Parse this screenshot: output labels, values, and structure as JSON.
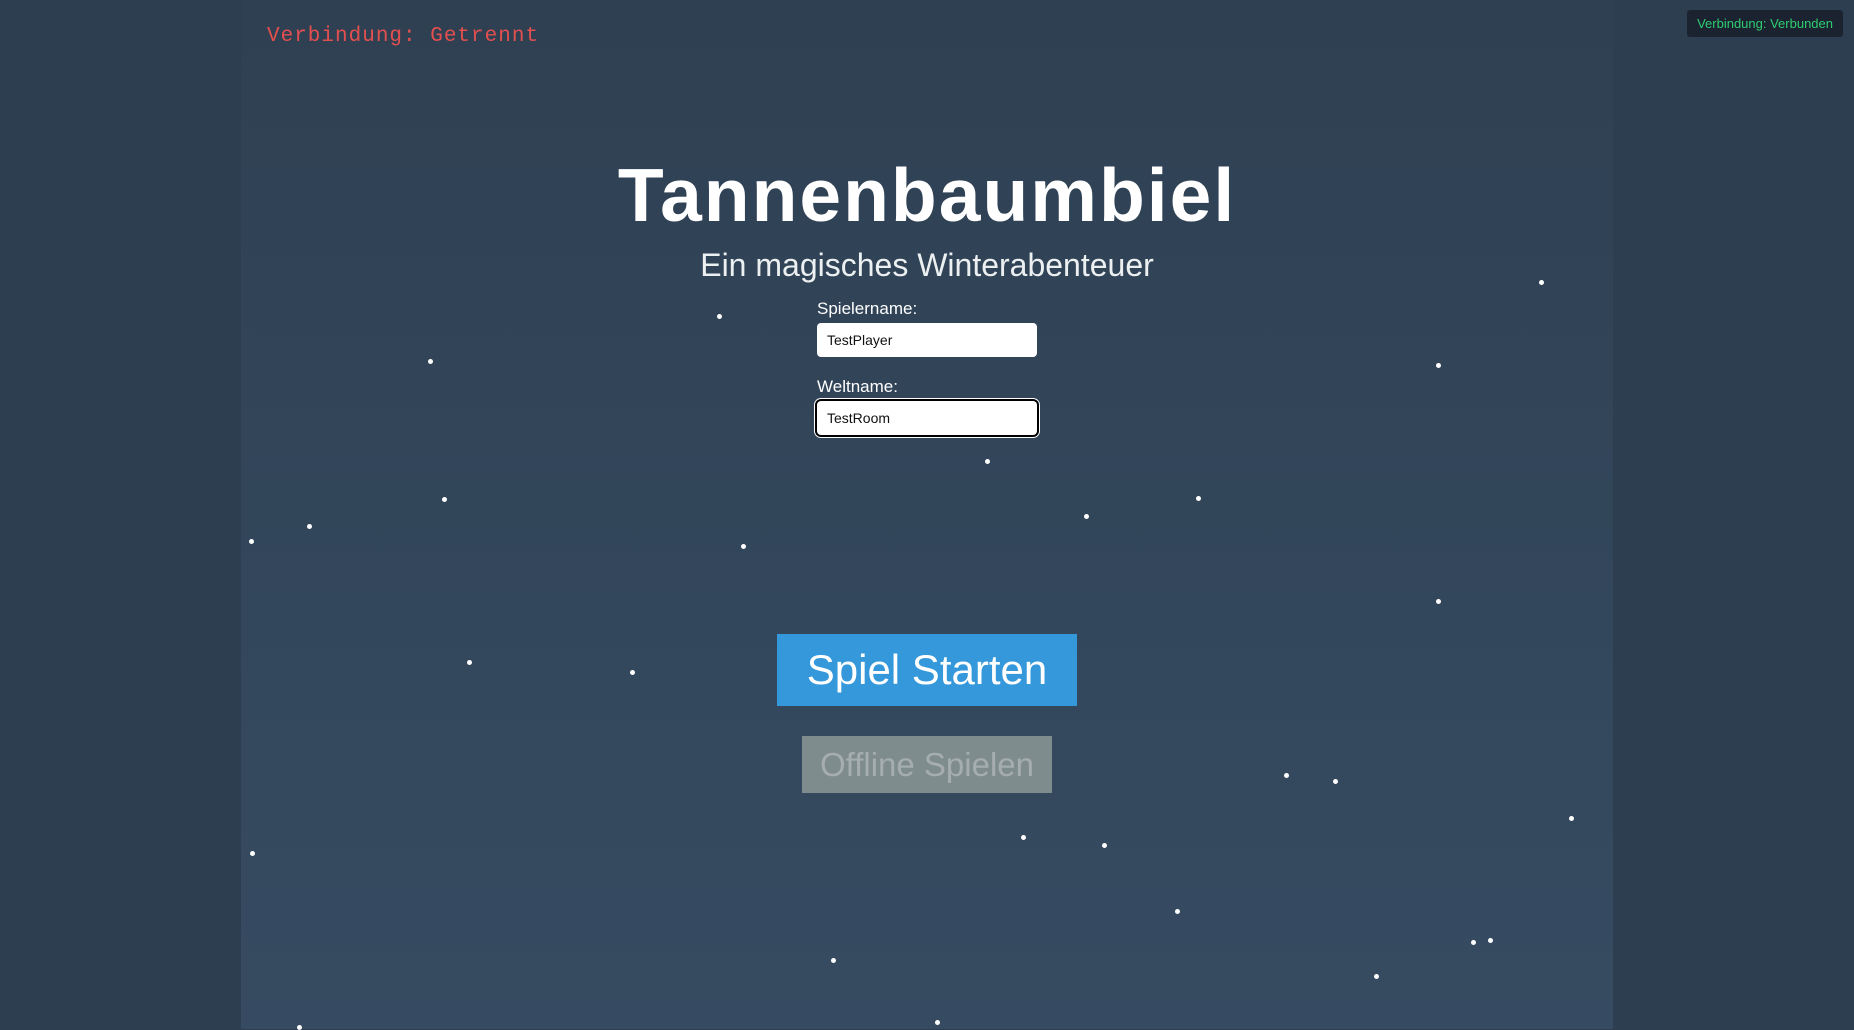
{
  "status": {
    "left": "Verbindung: Getrennt",
    "right": "Verbindung: Verbunden"
  },
  "menu": {
    "title": "Tannenbaumbiel",
    "subtitle": "Ein magisches Winterabenteuer",
    "player_label": "Spielername:",
    "player_value": "TestPlayer",
    "world_label": "Weltname:",
    "world_value": "TestRoom",
    "start_label": "Spiel Starten",
    "offline_label": "Offline Spielen"
  },
  "colors": {
    "background": "#2c3e50",
    "start_button": "#3498db",
    "offline_button": "#7f8c8d",
    "status_disconnected": "#e34f4f",
    "status_connected": "#2ecc71"
  },
  "icons": [
    "snowflake-icon"
  ]
}
